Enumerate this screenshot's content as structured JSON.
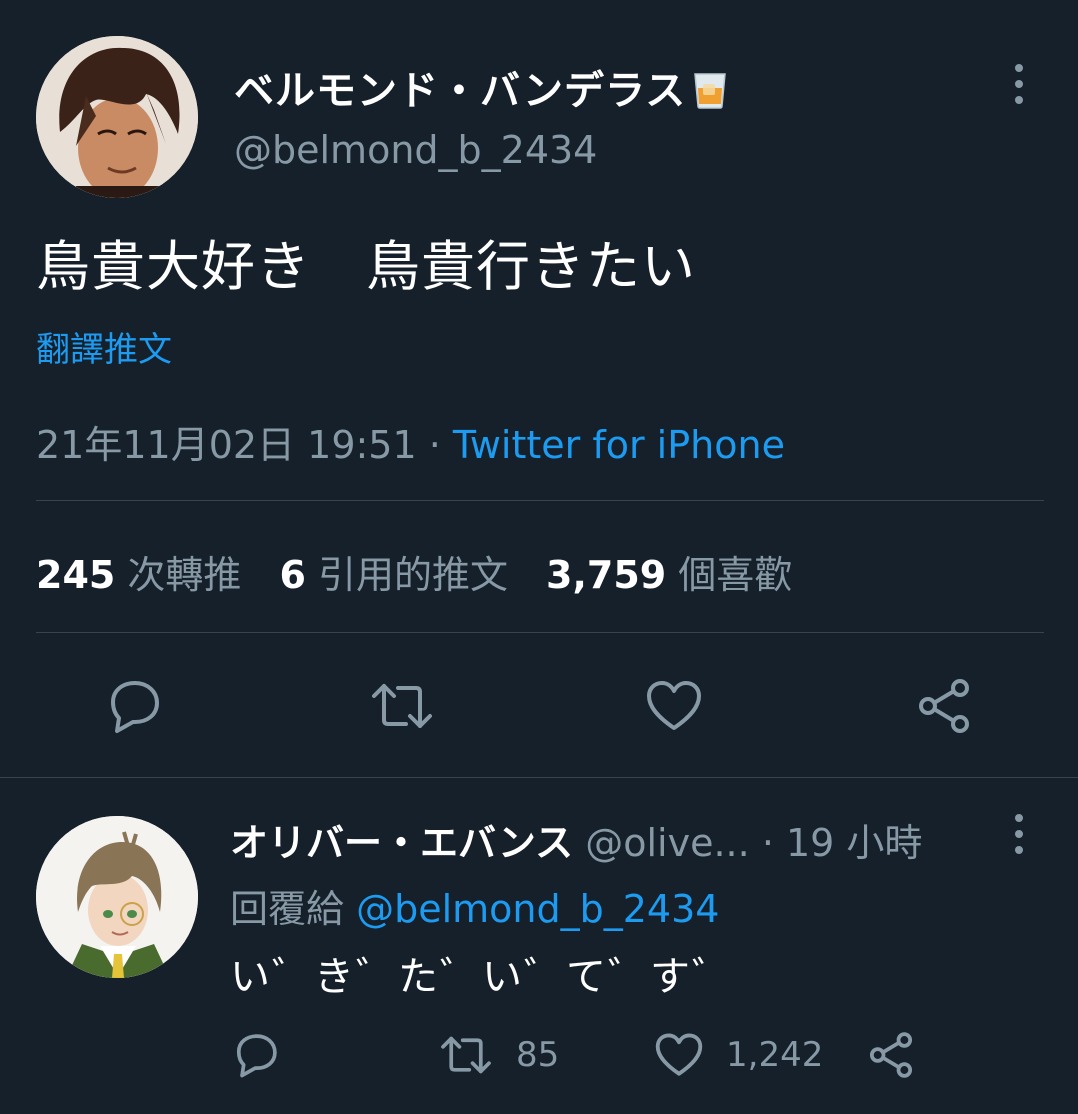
{
  "tweet": {
    "display_name": "ベルモンド・バンデラス",
    "name_emoji": "tumbler-glass-emoji",
    "handle": "@belmond_b_2434",
    "text": "鳥貴大好き　鳥貴行きたい",
    "translate_label": "翻譯推文",
    "timestamp": "21年11月02日 19:51",
    "separator": " · ",
    "source": "Twitter for iPhone",
    "stats": {
      "retweets": "245",
      "retweets_label": "次轉推",
      "quotes": "6",
      "quotes_label": "引用的推文",
      "likes": "3,759",
      "likes_label": "個喜歡"
    },
    "actions": {
      "reply_icon": "reply-icon",
      "retweet_icon": "retweet-icon",
      "like_icon": "heart-icon",
      "share_icon": "share-icon"
    }
  },
  "reply": {
    "display_name": "オリバー・エバンス",
    "handle": "@olive...",
    "time": "· 19 小時",
    "reply_prefix": "回覆給",
    "reply_mention": "@belmond_b_2434",
    "text": "い゛き゛た゛い゛て゛す゛",
    "retweet_count": "85",
    "like_count": "1,242"
  },
  "colors": {
    "background": "#15202b",
    "accent": "#1d9bf0",
    "muted": "#8899a6",
    "divider": "#38444d"
  }
}
